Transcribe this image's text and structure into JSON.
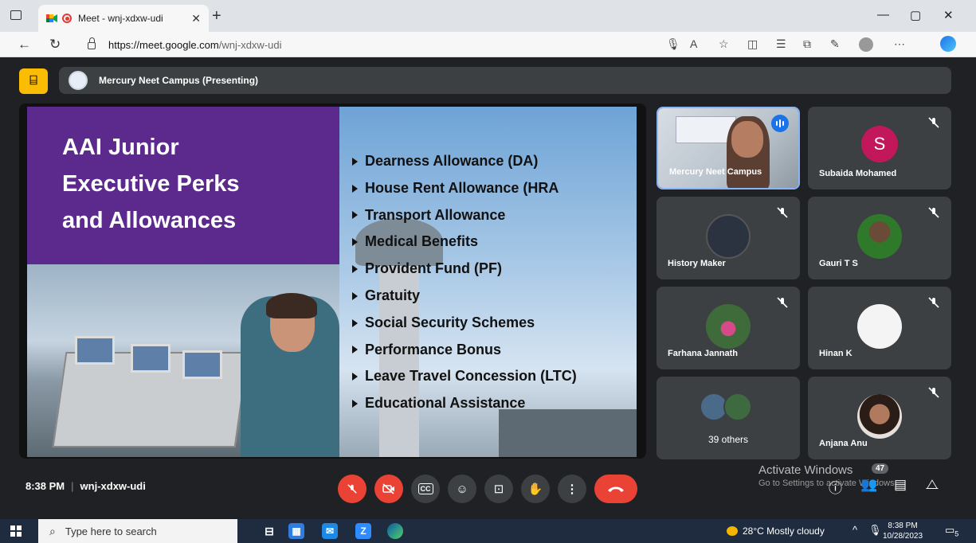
{
  "browser": {
    "tab_title": "Meet - wnj-xdxw-udi",
    "url_host": "https://meet.google.com",
    "url_path": "/wnj-xdxw-udi"
  },
  "meet": {
    "presenting_label": "Mercury Neet Campus (Presenting)",
    "slide": {
      "title_lines": [
        "AAI Junior",
        "Executive Perks",
        "and Allowances"
      ],
      "bullets": [
        "Dearness Allowance (DA)",
        "House Rent Allowance (HRA",
        "Transport Allowance",
        "Medical Benefits",
        "Provident Fund (PF)",
        "Gratuity",
        "Social Security Schemes",
        "Performance Bonus",
        "Leave Travel Concession (LTC)",
        "Educational Assistance"
      ]
    },
    "participants": [
      {
        "name": "Mercury Neet Campus",
        "speaking": true
      },
      {
        "name": "Subaida Mohamed",
        "initial": "S",
        "avatar_color": "#c2185b",
        "muted": true
      },
      {
        "name": "History Maker",
        "muted": true
      },
      {
        "name": "Gauri T S",
        "muted": true
      },
      {
        "name": "Farhana Jannath",
        "muted": true
      },
      {
        "name": "Hinan K",
        "muted": true
      },
      {
        "others_label": "39 others"
      },
      {
        "name": "Anjana Anu",
        "muted": true
      }
    ],
    "bottom": {
      "time": "8:38 PM",
      "meeting_code": "wnj-xdxw-udi",
      "activate_title": "Activate Windows",
      "activate_sub": "Go to Settings to activate Windows.",
      "people_count": "47"
    }
  },
  "taskbar": {
    "search_placeholder": "Type here to search",
    "weather": "28°C  Mostly cloudy",
    "time": "8:38 PM",
    "date": "10/28/2023",
    "notifications": "5"
  },
  "colors": {
    "meet_bg": "#202124",
    "tile_bg": "#3c4043",
    "slide_purple": "#5b2a8c",
    "danger": "#ea4335",
    "accent": "#8ab4f8"
  }
}
